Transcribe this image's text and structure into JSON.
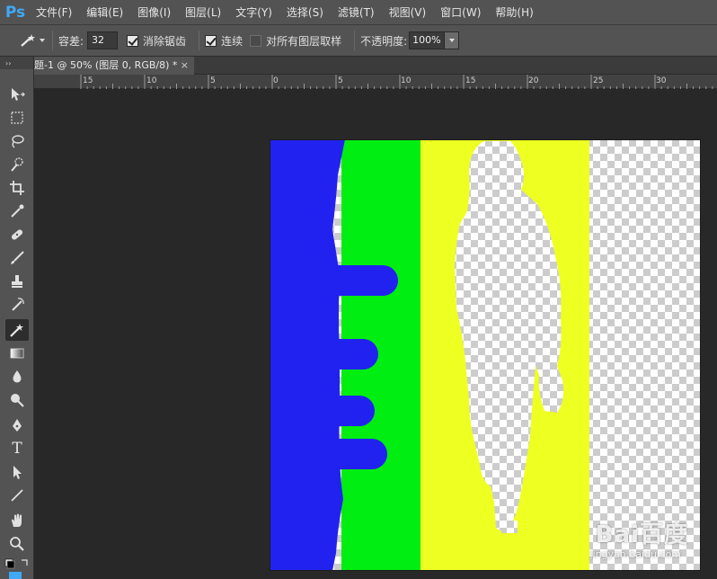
{
  "app": {
    "logo": "Ps"
  },
  "menu": [
    "文件(F)",
    "编辑(E)",
    "图像(I)",
    "图层(L)",
    "文字(Y)",
    "选择(S)",
    "滤镜(T)",
    "视图(V)",
    "窗口(W)",
    "帮助(H)"
  ],
  "options": {
    "tolerance_label": "容差:",
    "tolerance_value": "32",
    "antialias_label": "消除锯齿",
    "antialias_checked": true,
    "contiguous_label": "连续",
    "contiguous_checked": true,
    "sample_all_label": "对所有图层取样",
    "sample_all_checked": false,
    "opacity_label": "不透明度:",
    "opacity_value": "100%"
  },
  "document_tab": {
    "title": "题-1 @ 50% (图层 0, RGB/8) *",
    "close": "×"
  },
  "ruler": {
    "labels": [
      "15",
      "10",
      "5",
      "0",
      "5",
      "10",
      "15",
      "20",
      "25",
      "30"
    ]
  },
  "toolbar": {
    "collapse": "››",
    "tools": [
      "move-tool",
      "marquee-tool",
      "lasso-tool",
      "quick-select-tool",
      "crop-tool",
      "eyedropper-tool",
      "healing-tool",
      "brush-tool",
      "stamp-tool",
      "history-brush-tool",
      "eraser-tool",
      "gradient-tool",
      "blur-tool",
      "dodge-tool",
      "pen-tool",
      "type-tool",
      "path-select-tool",
      "line-tool",
      "hand-tool",
      "zoom-tool"
    ],
    "type_glyph": "T"
  },
  "colors": {
    "blue": "#2222f0",
    "green": "#00ee11",
    "yellow": "#eeff22",
    "accent": "#3fa9f5"
  },
  "watermark": {
    "brand": "Bai百度",
    "sub": "jingyan.baidu.com"
  }
}
